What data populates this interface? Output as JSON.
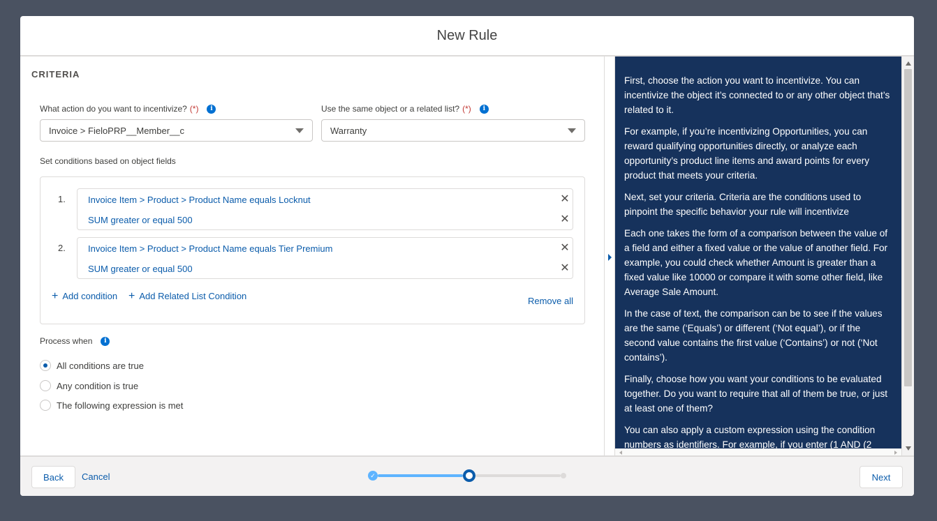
{
  "modal": {
    "title": "New Rule"
  },
  "criteria": {
    "heading": "CRITERIA",
    "action_label": "What action do you want to incentivize?",
    "action_required": "(*)",
    "action_value": "Invoice > FieloPRP__Member__c",
    "related_label": "Use the same object or a related list?",
    "related_required": "(*)",
    "related_value": "Warranty",
    "conditions_label": "Set conditions based on object fields",
    "conditions": [
      {
        "number": "1.",
        "line1": "Invoice Item > Product > Product Name equals Locknut",
        "line2": "SUM greater or equal 500"
      },
      {
        "number": "2.",
        "line1": "Invoice Item > Product > Product Name equals Tier Premium",
        "line2": "SUM greater or equal 500"
      }
    ],
    "add_condition": "Add condition",
    "add_related": "Add Related List Condition",
    "remove_all": "Remove all",
    "process_label": "Process when",
    "process_options": [
      {
        "label": "All conditions are true",
        "checked": true
      },
      {
        "label": "Any condition is true",
        "checked": false
      },
      {
        "label": "The following expression is met",
        "checked": false
      }
    ]
  },
  "help": {
    "paragraphs": [
      "First, choose the action you want to incentivize. You can incentivize the object it’s connected to or any other object that’s related to it.",
      "For example, if you’re incentivizing Opportunities, you can reward qualifying opportunities directly, or analyze each opportunity’s product line items and award points for every product that meets your criteria.",
      "Next, set your criteria. Criteria are the conditions used to pinpoint the specific behavior your rule will incentivize",
      "Each one takes the form of a comparison between the value of a field and either a fixed value or the value of another field. For example, you could check whether Amount is greater than a fixed value like 10000 or compare it with some other field, like Average Sale Amount.",
      "In the case of text, the comparison can be to see if the values are the same (‘Equals’) or different (‘Not equal’), or if the second value contains the first value (‘Contains’) or not (‘Not contains’).",
      "Finally, choose how you want your conditions to be evaluated together. Do you want to require that all of them be true, or just at least one of them?",
      "You can also apply a custom expression using the condition numbers as identifiers. For example, if you enter (1 AND (2"
    ]
  },
  "footer": {
    "back": "Back",
    "cancel": "Cancel",
    "next": "Next"
  },
  "progress": {
    "current_step": 2,
    "total_steps": 3
  },
  "colors": {
    "accent": "#0b5cab",
    "help_bg": "#16325c",
    "backdrop": "#4a5261"
  }
}
